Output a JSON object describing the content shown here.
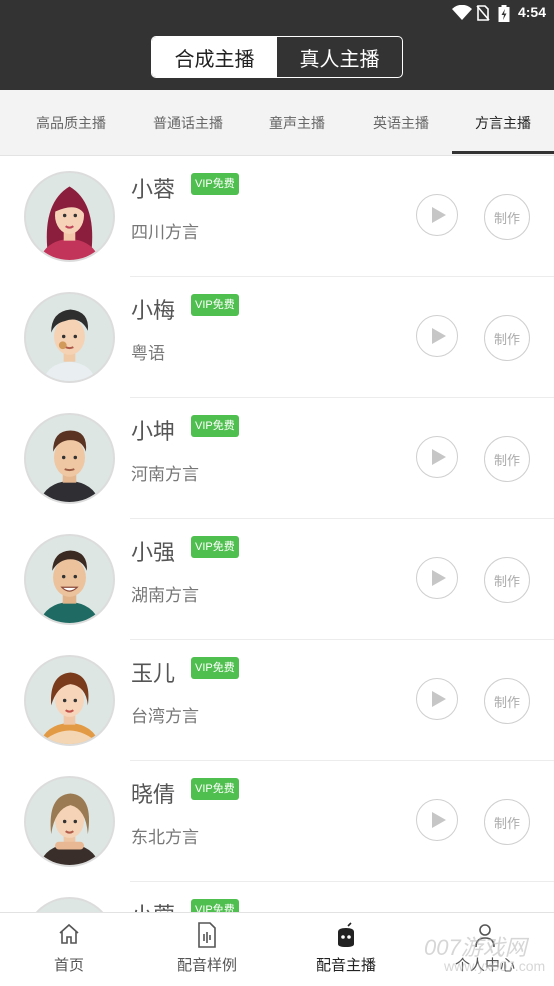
{
  "status_bar": {
    "time": "4:54"
  },
  "mode_switch": {
    "options": [
      "合成主播",
      "真人主播"
    ],
    "selected": "合成主播"
  },
  "categories": [
    {
      "label": "高品质主播"
    },
    {
      "label": "普通话主播"
    },
    {
      "label": "童声主播"
    },
    {
      "label": "英语主播"
    },
    {
      "label": "方言主播"
    }
  ],
  "active_category": "方言主播",
  "voices": [
    {
      "name": "小蓉",
      "badge": "VIP免费",
      "dialect": "四川方言",
      "make_label": "制作"
    },
    {
      "name": "小梅",
      "badge": "VIP免费",
      "dialect": "粤语",
      "make_label": "制作"
    },
    {
      "name": "小坤",
      "badge": "VIP免费",
      "dialect": "河南方言",
      "make_label": "制作"
    },
    {
      "name": "小强",
      "badge": "VIP免费",
      "dialect": "湖南方言",
      "make_label": "制作"
    },
    {
      "name": "玉儿",
      "badge": "VIP免费",
      "dialect": "台湾方言",
      "make_label": "制作"
    },
    {
      "name": "晓倩",
      "badge": "VIP免费",
      "dialect": "东北方言",
      "make_label": "制作"
    },
    {
      "name": "小蓉",
      "badge": "VIP免费",
      "dialect": "",
      "make_label": ""
    }
  ],
  "bottom_nav": [
    {
      "label": "首页",
      "icon": "home-icon"
    },
    {
      "label": "配音样例",
      "icon": "audio-file-icon"
    },
    {
      "label": "配音主播",
      "icon": "robot-icon"
    },
    {
      "label": "个人中心",
      "icon": "person-icon"
    }
  ],
  "active_nav": "配音主播",
  "watermark": {
    "text": "007游戏网",
    "url": "www.yx007.com"
  },
  "colors": {
    "header": "#333333",
    "vip_badge": "#4fc04f",
    "tab_bg": "#f3f3f3"
  }
}
